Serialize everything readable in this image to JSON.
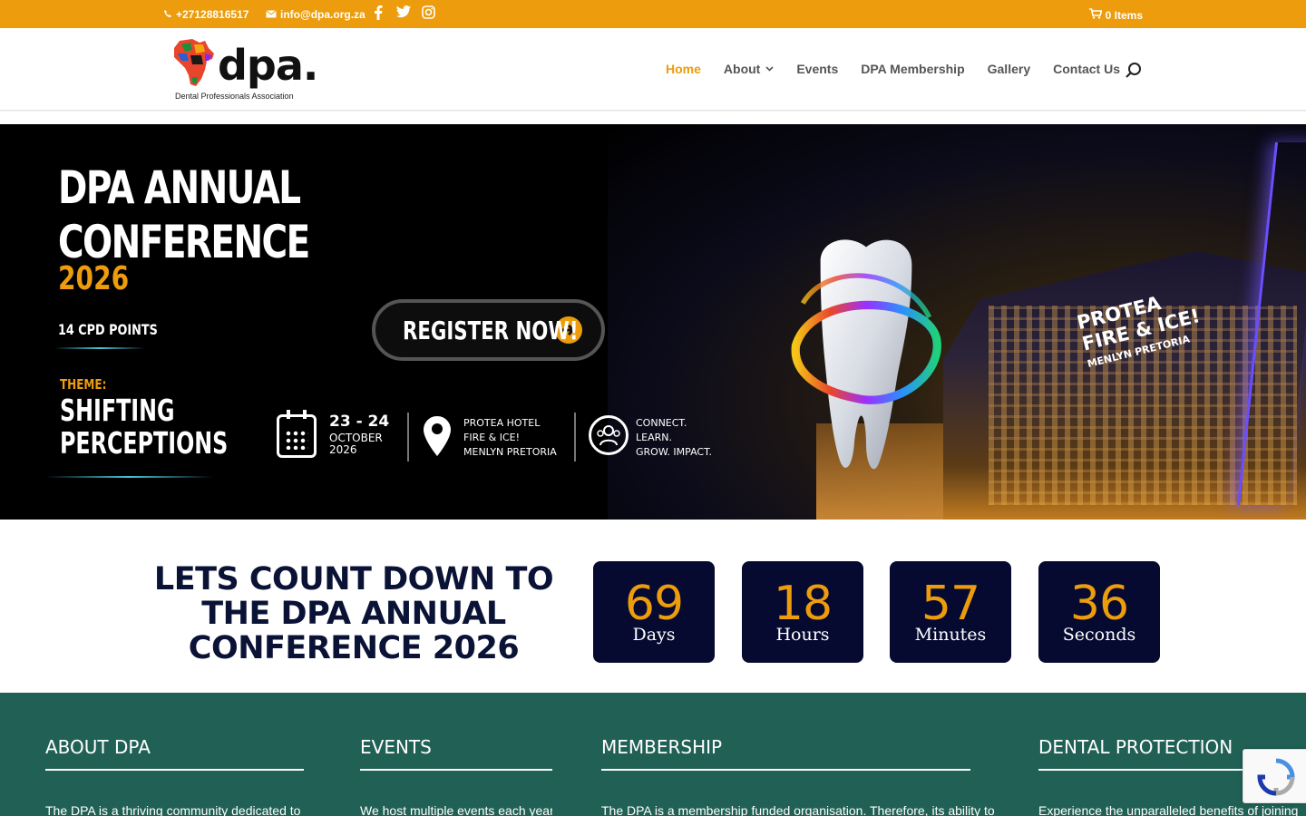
{
  "topbar": {
    "phone": "+27128816517",
    "email": "info@dpa.org.za",
    "cart": "0 Items"
  },
  "header": {
    "logo_text": "dpa.",
    "logo_tagline": "Dental Professionals Association",
    "nav": [
      {
        "label": "Home",
        "active": true
      },
      {
        "label": "About",
        "dropdown": true
      },
      {
        "label": "Events"
      },
      {
        "label": "DPA Membership"
      },
      {
        "label": "Gallery"
      },
      {
        "label": "Contact Us"
      }
    ]
  },
  "hero": {
    "title_line1": "DPA ANNUAL",
    "title_line2": "CONFERENCE",
    "year": "2026",
    "cpd": "14 CPD POINTS",
    "theme_label": "THEME:",
    "theme_line1": "SHIFTING",
    "theme_line2": "PERCEPTIONS",
    "register_label": "REGISTER NOW!",
    "date_big": "23 - 24",
    "date_month": "OCTOBER",
    "date_year": "2026",
    "venue_line1": "PROTEA HOTEL",
    "venue_line2": "FIRE & ICE!",
    "venue_line3": "MENLYN PRETORIA",
    "tag_line1": "CONNECT.",
    "tag_line2": "LEARN.",
    "tag_line3": "GROW. IMPACT.",
    "sign_line1": "PROTEA",
    "sign_line2": "FIRE & ICE!",
    "sign_line3": "MENLYN PRETORIA"
  },
  "countdown": {
    "title": "LETS COUNT DOWN TO THE DPA ANNUAL CONFERENCE 2026",
    "items": [
      {
        "value": "69",
        "unit": "Days"
      },
      {
        "value": "18",
        "unit": "Hours"
      },
      {
        "value": "57",
        "unit": "Minutes"
      },
      {
        "value": "36",
        "unit": "Seconds"
      }
    ]
  },
  "footer": {
    "columns": [
      {
        "heading": "ABOUT DPA",
        "text": "The DPA is a thriving community dedicated to"
      },
      {
        "heading": "EVENTS",
        "text": "We host multiple events each year, to"
      },
      {
        "heading": "MEMBERSHIP",
        "text": "The DPA is a membership funded organisation. Therefore, its ability to"
      },
      {
        "heading": "DENTAL PROTECTION",
        "text": "Experience the unparalleled benefits of joining"
      }
    ]
  },
  "colors": {
    "accent": "#ec9c0c",
    "navy": "#060a30",
    "footer_bg": "#216155"
  }
}
